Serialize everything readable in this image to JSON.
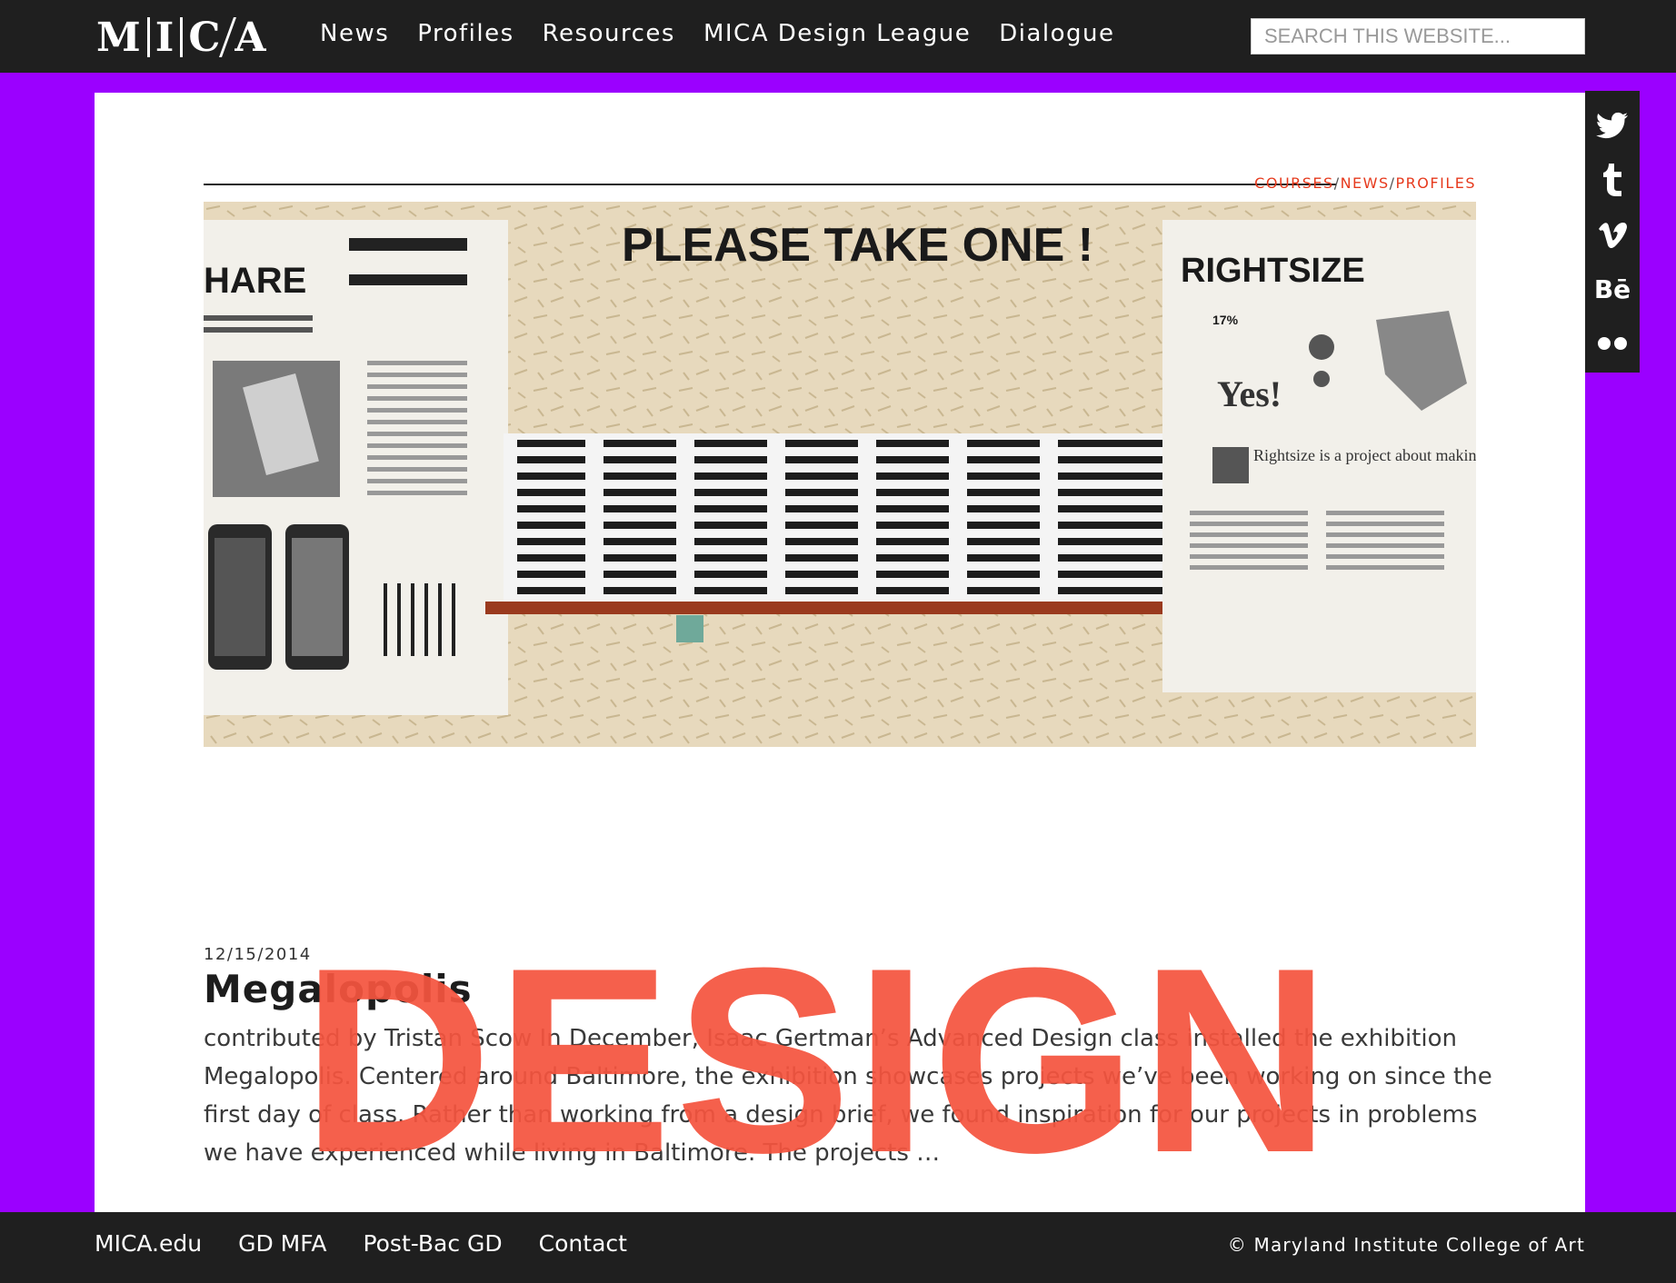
{
  "header": {
    "logo_letters": [
      "M",
      "I",
      "C",
      "A"
    ],
    "nav": [
      "News",
      "Profiles",
      "Resources",
      "MICA Design League",
      "Dialogue"
    ],
    "search_placeholder": "SEARCH THIS WEBSITE..."
  },
  "post": {
    "categories": [
      "COURSES",
      "NEWS",
      "PROFILES"
    ],
    "hero": {
      "sign": "PLEASE TAKE ONE !",
      "left_poster_heading": "HARE",
      "right_poster_heading": "RIGHTSIZE",
      "right_poster_stat": "17%",
      "right_poster_tagline": "Rightsize is a project about making Baltimore better.",
      "right_poster_yes": "Yes!"
    },
    "date": "12/15/2014",
    "title": "Megalopolis",
    "excerpt": "contributed by Tristan Scow In December, Isaac Gertman’s Advanced Design class installed the exhibition Megalopolis. Centered around Baltimore, the exhibition showcases projects we’ve been working on since the first day of class. Rather than working from a design brief, we found inspiration for our projects in problems we have experienced while living in Baltimore. The projects …",
    "overlay_word": "DESIGN"
  },
  "social": [
    "twitter-icon",
    "tumblr-icon",
    "vimeo-icon",
    "behance-icon",
    "flickr-icon"
  ],
  "footer": {
    "links": [
      "MICA.edu",
      "GD MFA",
      "Post-Bac GD",
      "Contact"
    ],
    "copyright": "© Maryland Institute College of Art"
  },
  "colors": {
    "background": "#9b00ff",
    "accent": "#e63a1d",
    "overlay": "#f5543f",
    "bar": "#1f1f1f"
  }
}
